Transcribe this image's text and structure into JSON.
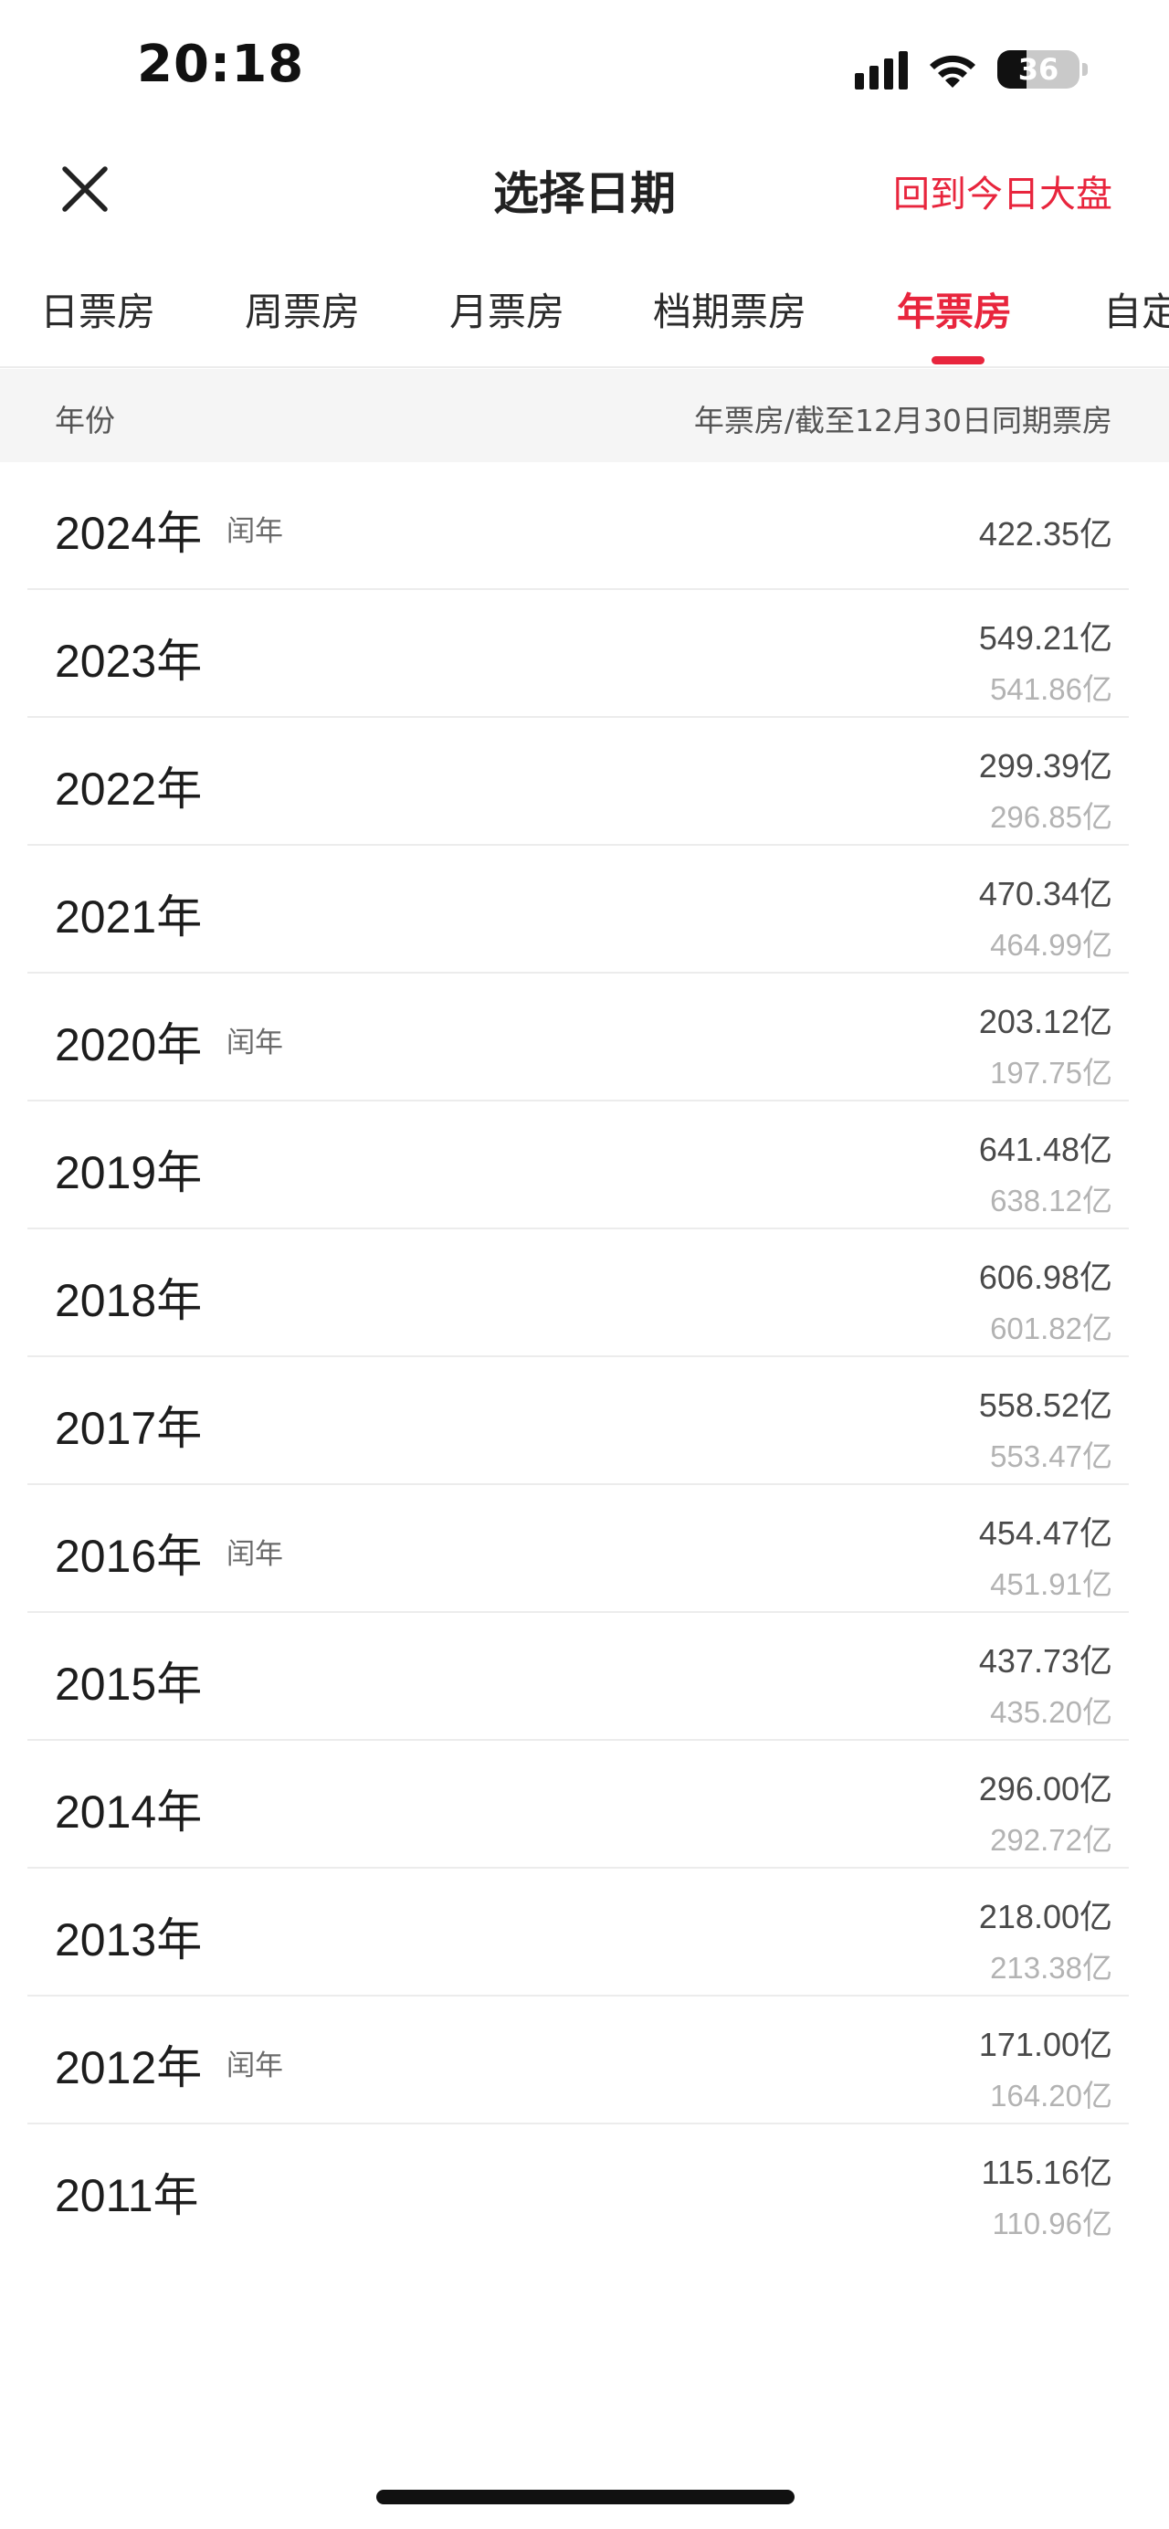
{
  "status_bar": {
    "time": "20:18",
    "battery_level": "36",
    "icons": [
      "signal-icon",
      "wifi-icon",
      "battery-icon"
    ]
  },
  "header": {
    "title": "选择日期",
    "back_to_today": "回到今日大盘",
    "close_icon": "close-icon"
  },
  "tabs": [
    {
      "label": "日票房",
      "active": false
    },
    {
      "label": "周票房",
      "active": false
    },
    {
      "label": "月票房",
      "active": false
    },
    {
      "label": "档期票房",
      "active": false
    },
    {
      "label": "年票房",
      "active": true
    },
    {
      "label": "自定",
      "active": false
    }
  ],
  "columns": {
    "left": "年份",
    "right": "年票房/截至12月30日同期票房"
  },
  "rows": [
    {
      "year": "2024年",
      "leap": "闰年",
      "total": "422.35亿",
      "same_period": ""
    },
    {
      "year": "2023年",
      "leap": "",
      "total": "549.21亿",
      "same_period": "541.86亿"
    },
    {
      "year": "2022年",
      "leap": "",
      "total": "299.39亿",
      "same_period": "296.85亿"
    },
    {
      "year": "2021年",
      "leap": "",
      "total": "470.34亿",
      "same_period": "464.99亿"
    },
    {
      "year": "2020年",
      "leap": "闰年",
      "total": "203.12亿",
      "same_period": "197.75亿"
    },
    {
      "year": "2019年",
      "leap": "",
      "total": "641.48亿",
      "same_period": "638.12亿"
    },
    {
      "year": "2018年",
      "leap": "",
      "total": "606.98亿",
      "same_period": "601.82亿"
    },
    {
      "year": "2017年",
      "leap": "",
      "total": "558.52亿",
      "same_period": "553.47亿"
    },
    {
      "year": "2016年",
      "leap": "闰年",
      "total": "454.47亿",
      "same_period": "451.91亿"
    },
    {
      "year": "2015年",
      "leap": "",
      "total": "437.73亿",
      "same_period": "435.20亿"
    },
    {
      "year": "2014年",
      "leap": "",
      "total": "296.00亿",
      "same_period": "292.72亿"
    },
    {
      "year": "2013年",
      "leap": "",
      "total": "218.00亿",
      "same_period": "213.38亿"
    },
    {
      "year": "2012年",
      "leap": "闰年",
      "total": "171.00亿",
      "same_period": "164.20亿"
    },
    {
      "year": "2011年",
      "leap": "",
      "total": "115.16亿",
      "same_period": "110.96亿"
    }
  ],
  "colors": {
    "accent": "#e8253d",
    "text": "#1d1d1d",
    "muted": "#b3b3b3",
    "header_bg": "#f5f5f5"
  }
}
